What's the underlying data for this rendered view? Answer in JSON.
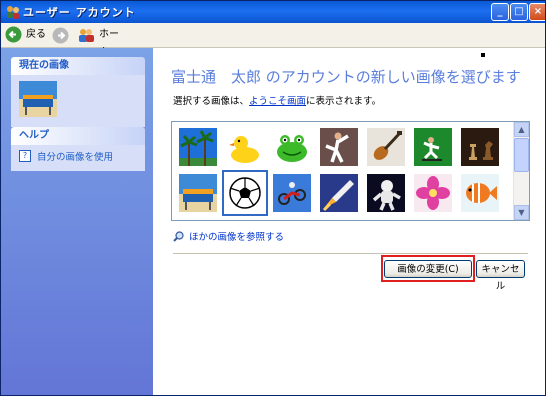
{
  "window": {
    "title": "ユーザー アカウント"
  },
  "toolbar": {
    "back_label": "戻る",
    "home_label": "ホーム"
  },
  "sidebar": {
    "current_picture_heading": "現在の画像",
    "help_heading": "ヘルプ",
    "help_items": [
      {
        "label": "自分の画像を使用"
      }
    ]
  },
  "main": {
    "heading": "富士通　太郎 のアカウントの新しい画像を選びます",
    "subtext_before": "選択する画像は、",
    "subtext_link": "ようこそ画面",
    "subtext_after": "に表示されます。",
    "pictures": [
      "palm-trees",
      "rubber-duck",
      "frog",
      "karate",
      "guitar",
      "skateboarder",
      "chess",
      "beach-chairs",
      "soccer-ball",
      "motocross",
      "space-shuttle",
      "astronaut",
      "flower",
      "fish"
    ],
    "selected_picture": "soccer-ball",
    "browse_label": "ほかの画像を参照する",
    "change_button": "画像の変更(C)",
    "cancel_button": "キャンセル"
  }
}
